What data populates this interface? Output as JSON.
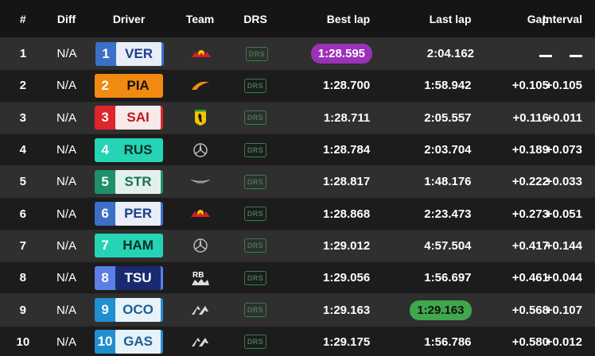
{
  "headers": {
    "pos": "#",
    "diff": "Diff",
    "driver": "Driver",
    "team": "Team",
    "drs": "DRS",
    "best": "Best lap",
    "last": "Last lap",
    "gap": "Gap",
    "interval": "Interval"
  },
  "rows": [
    {
      "pos": "1",
      "diff": "N/A",
      "num": "1",
      "code": "VER",
      "team_icon": "red-bull-icon",
      "drs": "DRS",
      "best": "1:28.595",
      "last": "2:04.162",
      "gap": "—",
      "interval": "—",
      "num_bg": "#3b6fc8",
      "code_bg": "#e8edf8",
      "code_fg": "#1e3f8a"
    },
    {
      "pos": "2",
      "diff": "N/A",
      "num": "2",
      "code": "PIA",
      "team_icon": "mclaren-icon",
      "drs": "DRS",
      "best": "1:28.700",
      "last": "1:58.942",
      "gap": "+0.105",
      "interval": "+0.105",
      "num_bg": "#f08a12",
      "code_bg": "#f08a12",
      "code_fg": "#111111"
    },
    {
      "pos": "3",
      "diff": "N/A",
      "num": "3",
      "code": "SAI",
      "team_icon": "ferrari-icon",
      "drs": "DRS",
      "best": "1:28.711",
      "last": "2:05.557",
      "gap": "+0.116",
      "interval": "+0.011",
      "num_bg": "#e0242b",
      "code_bg": "#f7eaea",
      "code_fg": "#c0151b"
    },
    {
      "pos": "4",
      "diff": "N/A",
      "num": "4",
      "code": "RUS",
      "team_icon": "mercedes-icon",
      "drs": "DRS",
      "best": "1:28.784",
      "last": "2:03.704",
      "gap": "+0.189",
      "interval": "+0.073",
      "num_bg": "#25d4b4",
      "code_bg": "#25d4b4",
      "code_fg": "#0b2e28"
    },
    {
      "pos": "5",
      "diff": "N/A",
      "num": "5",
      "code": "STR",
      "team_icon": "aston-martin-icon",
      "drs": "DRS",
      "best": "1:28.817",
      "last": "1:48.176",
      "gap": "+0.222",
      "interval": "+0.033",
      "num_bg": "#1f8f6c",
      "code_bg": "#e3f1ec",
      "code_fg": "#157055"
    },
    {
      "pos": "6",
      "diff": "N/A",
      "num": "6",
      "code": "PER",
      "team_icon": "red-bull-icon",
      "drs": "DRS",
      "best": "1:28.868",
      "last": "2:23.473",
      "gap": "+0.273",
      "interval": "+0.051",
      "num_bg": "#3b6fc8",
      "code_bg": "#e8edf8",
      "code_fg": "#1e3f8a"
    },
    {
      "pos": "7",
      "diff": "N/A",
      "num": "7",
      "code": "HAM",
      "team_icon": "mercedes-icon",
      "drs": "DRS",
      "best": "1:29.012",
      "last": "4:57.504",
      "gap": "+0.417",
      "interval": "+0.144",
      "num_bg": "#25d4b4",
      "code_bg": "#25d4b4",
      "code_fg": "#0b2e28"
    },
    {
      "pos": "8",
      "diff": "N/A",
      "num": "8",
      "code": "TSU",
      "team_icon": "rb-icon",
      "drs": "DRS",
      "best": "1:29.056",
      "last": "1:56.697",
      "gap": "+0.461",
      "interval": "+0.044",
      "num_bg": "#5b7fe6",
      "code_bg": "#1a2a6e",
      "code_fg": "#ffffff"
    },
    {
      "pos": "9",
      "diff": "N/A",
      "num": "9",
      "code": "OCO",
      "team_icon": "alpine-icon",
      "drs": "DRS",
      "best": "1:29.163",
      "last": "1:29.163",
      "gap": "+0.568",
      "interval": "+0.107",
      "num_bg": "#1f8fd0",
      "code_bg": "#e6f2fa",
      "code_fg": "#1d5e8e"
    },
    {
      "pos": "10",
      "diff": "N/A",
      "num": "10",
      "code": "GAS",
      "team_icon": "alpine-icon",
      "drs": "DRS",
      "best": "1:29.175",
      "last": "1:56.786",
      "gap": "+0.580",
      "interval": "+0.012",
      "num_bg": "#1f8fd0",
      "code_bg": "#e6f2fa",
      "code_fg": "#1d5e8e"
    }
  ],
  "highlights": {
    "purple_best_row": 0,
    "green_last_row": 8,
    "purple": "#9b31b8",
    "green": "#3fa84c"
  }
}
